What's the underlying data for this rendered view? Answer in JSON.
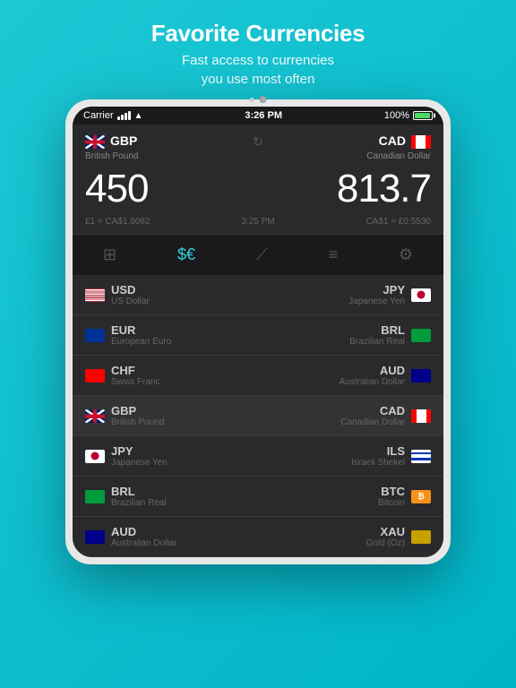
{
  "header": {
    "title": "Favorite Currencies",
    "subtitle_line1": "Fast access to currencies",
    "subtitle_line2": "you use most often"
  },
  "status_bar": {
    "carrier": "Carrier",
    "time": "3:26 PM",
    "battery": "100%"
  },
  "converter": {
    "left_code": "GBP",
    "left_name": "British Pound",
    "right_code": "CAD",
    "right_name": "Canadian Dollar",
    "left_amount": "450",
    "right_amount": "813.7",
    "rate_left": "£1 = CA$1.8082",
    "rate_time": "3:25 PM",
    "rate_right": "CA$1 = £0.5530"
  },
  "tabs": [
    {
      "label": "calculator",
      "icon": "⊞",
      "active": false
    },
    {
      "label": "currency",
      "icon": "$€",
      "active": true
    },
    {
      "label": "chart",
      "icon": "📈",
      "active": false
    },
    {
      "label": "list",
      "icon": "≡",
      "active": false
    },
    {
      "label": "settings",
      "icon": "⚙",
      "active": false
    }
  ],
  "currency_list": [
    {
      "left_code": "USD",
      "left_name": "US Dollar",
      "left_flag": "us",
      "right_code": "JPY",
      "right_name": "Japanese Yen",
      "right_flag": "jp",
      "highlighted": false
    },
    {
      "left_code": "EUR",
      "left_name": "European Euro",
      "left_flag": "eu",
      "right_code": "BRL",
      "right_name": "Brazilian Real",
      "right_flag": "br",
      "highlighted": false
    },
    {
      "left_code": "CHF",
      "left_name": "Swiss Franc",
      "left_flag": "ch",
      "right_code": "AUD",
      "right_name": "Australian Dollar",
      "right_flag": "au",
      "highlighted": false
    },
    {
      "left_code": "GBP",
      "left_name": "British Pound",
      "left_flag": "uk",
      "right_code": "CAD",
      "right_name": "Canadian Dollar",
      "right_flag": "ca",
      "highlighted": true
    },
    {
      "left_code": "JPY",
      "left_name": "Japanese Yen",
      "left_flag": "jp",
      "right_code": "ILS",
      "right_name": "Israeli Shekel",
      "right_flag": "il",
      "highlighted": false
    },
    {
      "left_code": "BRL",
      "left_name": "Brazilian Real",
      "left_flag": "br",
      "right_code": "BTC",
      "right_name": "Bitcoin",
      "right_flag": "btc",
      "highlighted": false
    },
    {
      "left_code": "AUD",
      "left_name": "Australian Dollar",
      "left_flag": "au",
      "right_code": "XAU",
      "right_name": "Gold (Oz)",
      "right_flag": "xau",
      "highlighted": false
    }
  ]
}
